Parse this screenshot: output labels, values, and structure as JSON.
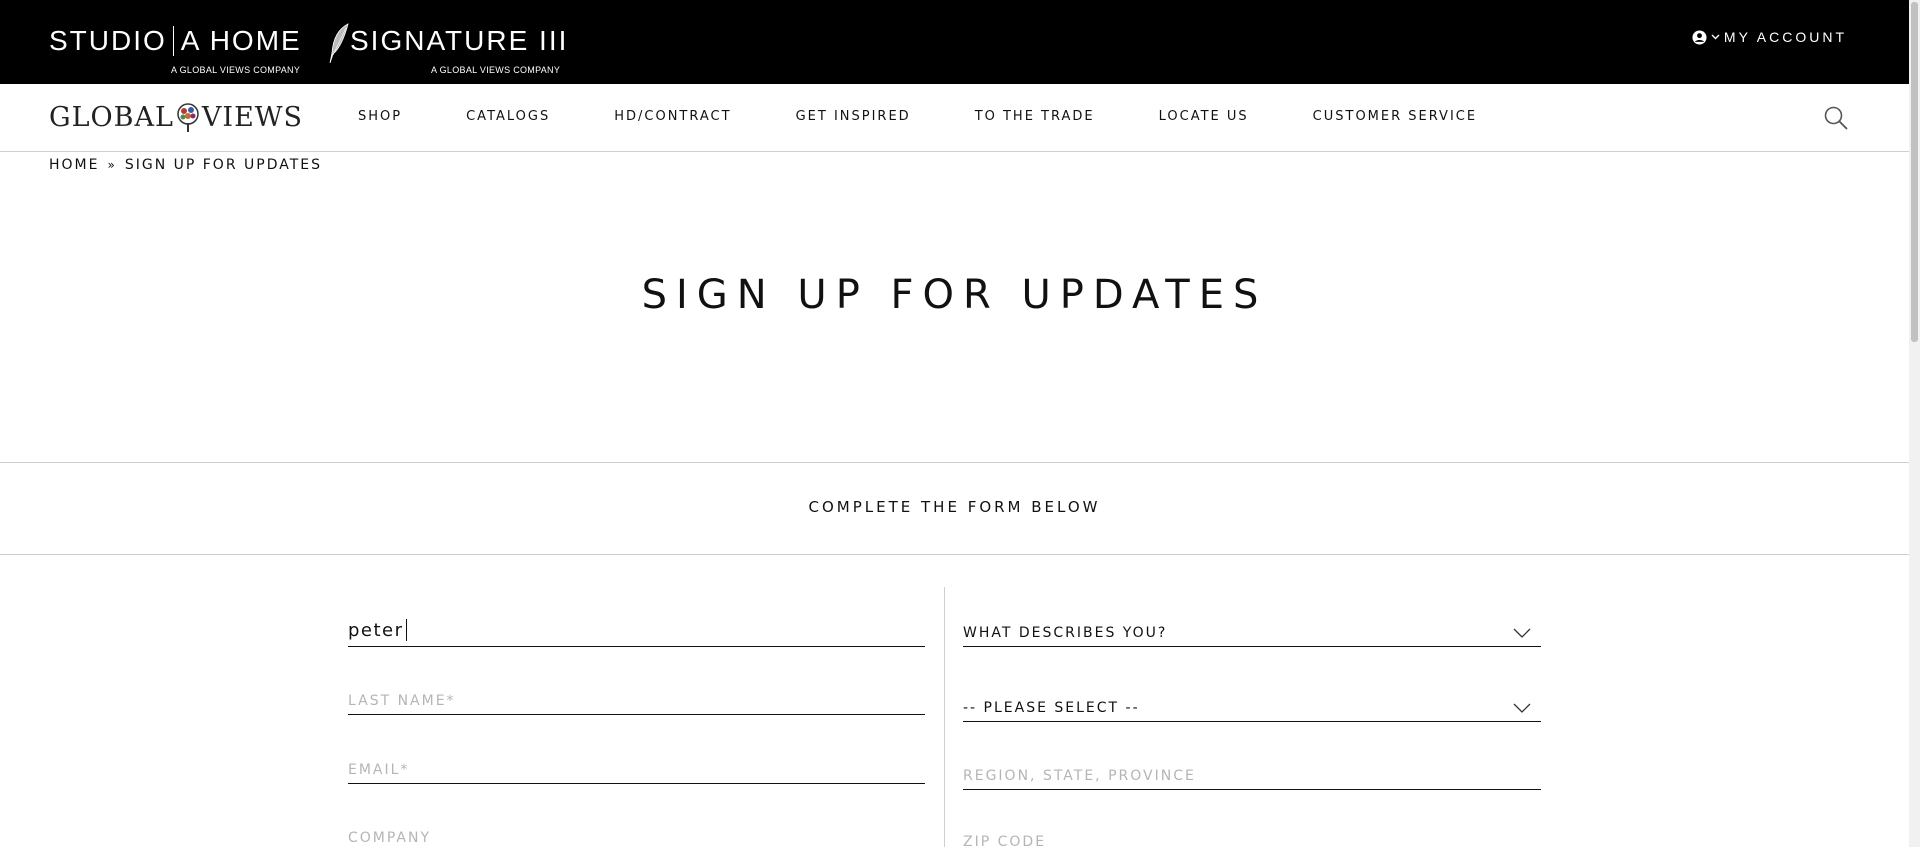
{
  "brands": {
    "studio": {
      "name_left": "STUDIO",
      "name_right": "A  HOME",
      "sub": "A GLOBAL VIEWS COMPANY"
    },
    "signature": {
      "name": "SIGNATURE III",
      "sub": "A GLOBAL VIEWS COMPANY"
    }
  },
  "account": {
    "label": "MY ACCOUNT"
  },
  "logo": {
    "left": "GLOBAL",
    "right": "VIEWS"
  },
  "nav": {
    "items": [
      "SHOP",
      "CATALOGS",
      "HD/CONTRACT",
      "GET INSPIRED",
      "TO THE TRADE",
      "LOCATE US",
      "CUSTOMER SERVICE"
    ]
  },
  "breadcrumb": {
    "home": "HOME",
    "sep": "»",
    "current": "SIGN UP FOR UPDATES"
  },
  "page_title": "SIGN UP FOR UPDATES",
  "form_heading": "COMPLETE THE FORM BELOW",
  "form": {
    "first_name_value": "peter",
    "last_name_placeholder": "LAST NAME*",
    "email_placeholder": "EMAIL*",
    "company_placeholder": "COMPANY",
    "describes_label": "WHAT DESCRIBES YOU?",
    "select_label": "-- PLEASE SELECT --",
    "region_placeholder": "REGION, STATE, PROVINCE",
    "zip_placeholder": "ZIP CODE"
  },
  "colors": {
    "topbar": "#000000",
    "text": "#111111",
    "placeholder": "#b5b5b5",
    "divider": "#cfcfcf"
  }
}
